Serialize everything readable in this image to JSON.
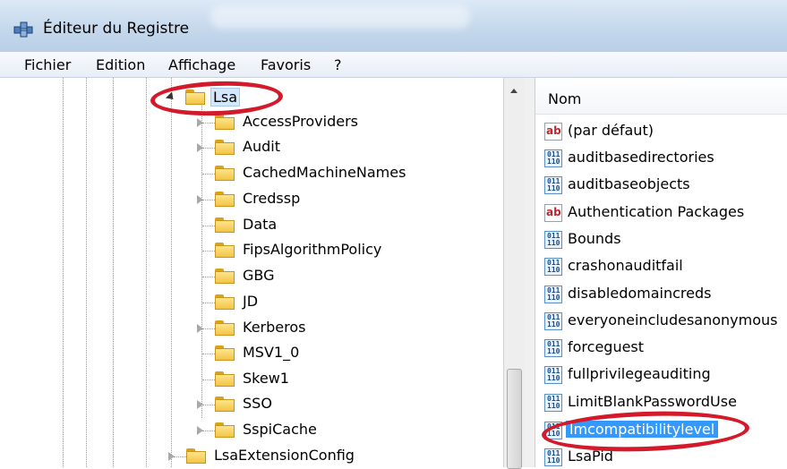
{
  "window": {
    "title": "Éditeur du Registre",
    "icon": "registry-editor-icon"
  },
  "menu": [
    {
      "label": "Fichier"
    },
    {
      "label": "Edition"
    },
    {
      "label": "Affichage"
    },
    {
      "label": "Favoris"
    },
    {
      "label": "?"
    }
  ],
  "tree": {
    "selected": {
      "label": "Lsa",
      "expanded": true
    },
    "children": [
      {
        "label": "AccessProviders",
        "has_children": true
      },
      {
        "label": "Audit",
        "has_children": true
      },
      {
        "label": "CachedMachineNames",
        "has_children": false
      },
      {
        "label": "Credssp",
        "has_children": true
      },
      {
        "label": "Data",
        "has_children": false
      },
      {
        "label": "FipsAlgorithmPolicy",
        "has_children": false
      },
      {
        "label": "GBG",
        "has_children": false
      },
      {
        "label": "JD",
        "has_children": false
      },
      {
        "label": "Kerberos",
        "has_children": true
      },
      {
        "label": "MSV1_0",
        "has_children": false
      },
      {
        "label": "Skew1",
        "has_children": false
      },
      {
        "label": "SSO",
        "has_children": true
      },
      {
        "label": "SspiCache",
        "has_children": true
      }
    ],
    "sibling": {
      "label": "LsaExtensionConfig",
      "has_children": true
    }
  },
  "values": {
    "column_header": "Nom",
    "items": [
      {
        "name": "(par défaut)",
        "type": "string",
        "icon": "ab"
      },
      {
        "name": "auditbasedirectories",
        "type": "binary",
        "icon": "011 110"
      },
      {
        "name": "auditbaseobjects",
        "type": "binary",
        "icon": "011 110"
      },
      {
        "name": "Authentication Packages",
        "type": "string",
        "icon": "ab"
      },
      {
        "name": "Bounds",
        "type": "binary",
        "icon": "011 110"
      },
      {
        "name": "crashonauditfail",
        "type": "binary",
        "icon": "011 110"
      },
      {
        "name": "disabledomaincreds",
        "type": "binary",
        "icon": "011 110"
      },
      {
        "name": "everyoneincludesanonymous",
        "type": "binary",
        "icon": "011 110"
      },
      {
        "name": "forceguest",
        "type": "binary",
        "icon": "011 110"
      },
      {
        "name": "fullprivilegeauditing",
        "type": "binary",
        "icon": "011 110"
      },
      {
        "name": "LimitBlankPasswordUse",
        "type": "binary",
        "icon": "011 110"
      },
      {
        "name": "lmcompatibilitylevel",
        "type": "binary",
        "icon": "011 110",
        "selected": true
      },
      {
        "name": "LsaPid",
        "type": "binary",
        "icon": "011 110"
      }
    ]
  },
  "colors": {
    "annotation": "#d21a2a",
    "selection": "#3399ff"
  }
}
